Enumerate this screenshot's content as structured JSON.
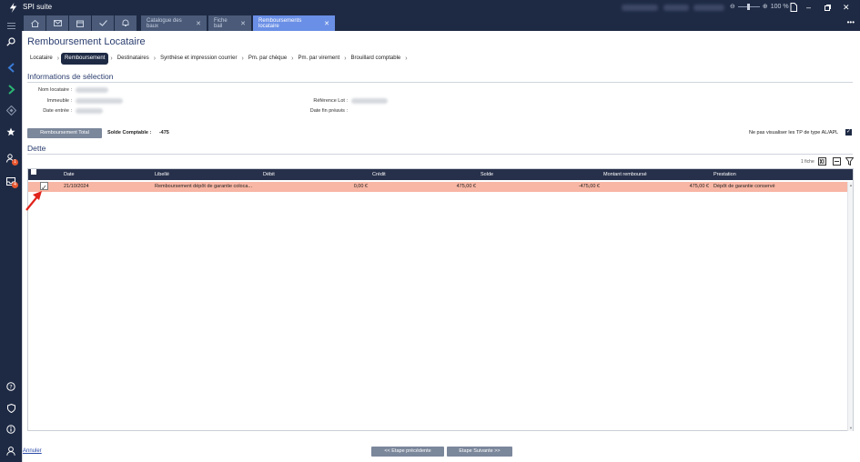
{
  "app": {
    "title": "SPI suite",
    "zoom": "100 %"
  },
  "tabs": [
    {
      "label": "Catalogue des baux"
    },
    {
      "label": "Fiche bail"
    },
    {
      "label": "Remboursements locataire"
    }
  ],
  "tab_close": "✕",
  "sidebar": {
    "badges": [
      "1",
      "4"
    ]
  },
  "page": {
    "title": "Remboursement Locataire",
    "steps": [
      "Locataire",
      "Remboursement",
      "Destinataires",
      "Synthèse et impression courrier",
      "Pm. par chèque",
      "Pm. par virement",
      "Brouillard comptable"
    ]
  },
  "selection": {
    "title": "Informations de sélection",
    "labels": {
      "nom_locataire": "Nom locataire :",
      "immeuble": "Immeuble :",
      "date_entree": "Date entrée :",
      "reference_lot": "Référence Lot :",
      "date_fin_preavis": "Date fin préavis :"
    }
  },
  "actions": {
    "remboursement_total": "Remboursement Total",
    "solde_label": "Solde Comptable :",
    "solde_value": "-475",
    "tp_label": "Ne pas visualiser les TP de type AL/APL",
    "tp_checked": true
  },
  "dette": {
    "title": "Dette",
    "count": "1 fiche",
    "columns": [
      "Date",
      "Libellé",
      "Débit",
      "Crédit",
      "Solde",
      "Montant remboursé",
      "Prestation"
    ],
    "rows": [
      {
        "checked": true,
        "date": "21/10/2024",
        "libelle": "Remboursement dépôt de garantie coloca...",
        "debit": "0,00 €",
        "credit": "475,00 €",
        "solde": "-475,00 €",
        "montant": "475,00 €",
        "prestation": "Dépôt de garantie conservé"
      }
    ]
  },
  "footer": {
    "annuler": "Annuler",
    "prev": "<< Etape précédente",
    "next": "Etape Suivante >>"
  },
  "colors": {
    "navy": "#1e2a44",
    "tab_active": "#6a8fe6",
    "row_highlight": "#f8b6a4",
    "header_bg": "#27304a",
    "arrow_red": "#e0231b",
    "accent_green": "#2bb673",
    "accent_blue": "#3a7bd5",
    "badge_orange": "#e8572f"
  },
  "icons": [
    "app-logo-icon",
    "home-icon",
    "mail-icon",
    "calendar-icon",
    "check-icon",
    "bell-icon",
    "search-icon",
    "arrow-left-icon",
    "arrow-right-icon",
    "diamond-icon",
    "star-icon",
    "user-lock-icon",
    "inbox-icon",
    "help-icon",
    "shield-icon",
    "info-icon",
    "user-icon",
    "export-excel-icon",
    "add-icon",
    "filter-icon",
    "red-arrow-annotation"
  ]
}
